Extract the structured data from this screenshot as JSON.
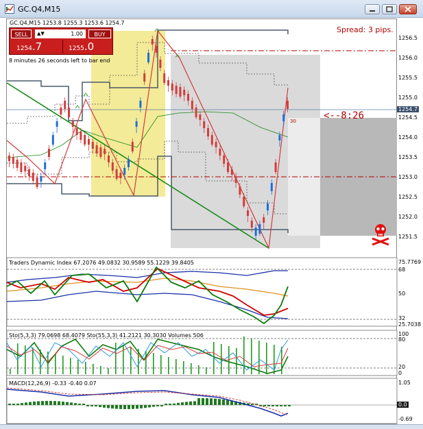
{
  "window": {
    "title": "GC.Q4,M15"
  },
  "chart_header": {
    "info_line": "GC.Q4,M15  1253.8 1255.3 1253.6 1254.7",
    "bar_end_text": "8 minutes 26 seconds left to bar end",
    "spread_text": "Spread: 3 pips.",
    "timer_text": "<--8:26",
    "candle_count_label": "30"
  },
  "trade_panel": {
    "sell_label": "SELL",
    "buy_label": "BUY",
    "lot_value": "1.00",
    "sell_price_prefix": "1254",
    "sell_price_big": ".7",
    "buy_price_prefix": "1255",
    "buy_price_big": ".0"
  },
  "price_scale": {
    "ticks": [
      "1256.5",
      "1256.0",
      "1255.5",
      "1255.0",
      "1254.5",
      "1254.0",
      "1253.5",
      "1253.0",
      "1252.5",
      "1252.0",
      "1251.5"
    ],
    "current_price_label": "1254.7"
  },
  "indicators": {
    "tdi": {
      "label": "Traders Dynamic Index 67.2076 49.0832 30.9589 55.1229 39.8405",
      "scale": [
        "75.7769",
        "68",
        "50",
        "32",
        "25.7038"
      ]
    },
    "stochastic": {
      "label": "Sto(5,3,3) 79.0698 68.4079  Sto(55,3,3) 41.2121 30.3030  Volumes 506",
      "scale": [
        "100",
        "80",
        "20",
        "0"
      ]
    },
    "macd": {
      "label": "MACD(12,26,9) -0.33 -0.40 0.07",
      "scale": [
        "1.05",
        "0.0",
        "-0.69"
      ]
    }
  },
  "colors": {
    "bull_candle": "#1f6fd6",
    "bear_candle": "#d23c3c",
    "resistance_line": "#b00000",
    "trend_line": "#1a8a1a",
    "channel_line": "#4a5a6a",
    "highlight_zone": "#f2e98c",
    "range_zone": "#d3d3d3"
  }
}
